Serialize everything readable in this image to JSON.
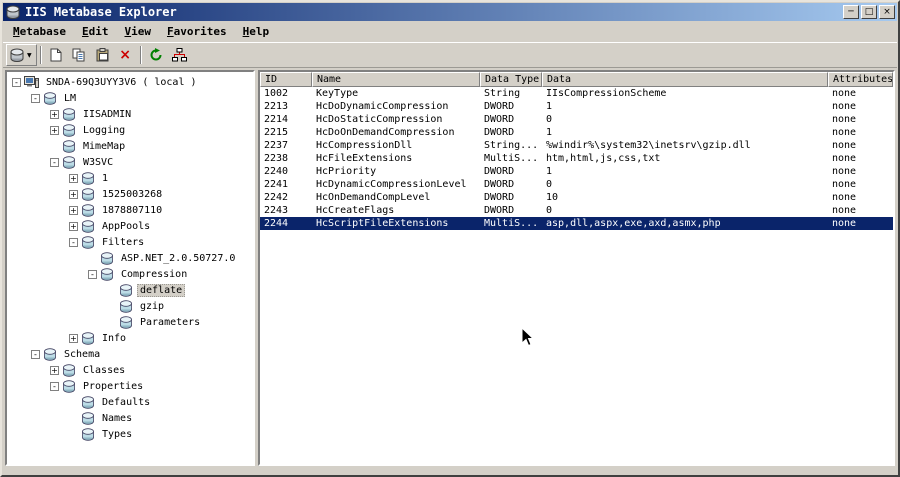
{
  "window": {
    "title": "IIS Metabase Explorer",
    "controls": {
      "minimize": "─",
      "maximize": "□",
      "close": "×"
    }
  },
  "menu": {
    "items": [
      {
        "label": "Metabase"
      },
      {
        "label": "Edit"
      },
      {
        "label": "View"
      },
      {
        "label": "Favorites"
      },
      {
        "label": "Help"
      }
    ]
  },
  "toolbar": {
    "buttons": [
      "connect",
      "new-key",
      "copy",
      "paste",
      "delete",
      "refresh",
      "network"
    ]
  },
  "tree": {
    "items": [
      {
        "label": "SNDA-69Q3UYY3V6 ( local )",
        "level": 0,
        "expander": "minus",
        "icon": "computer"
      },
      {
        "label": "LM",
        "level": 1,
        "expander": "minus",
        "icon": "db"
      },
      {
        "label": "IISADMIN",
        "level": 2,
        "expander": "plus",
        "icon": "db"
      },
      {
        "label": "Logging",
        "level": 2,
        "expander": "plus",
        "icon": "db"
      },
      {
        "label": "MimeMap",
        "level": 2,
        "expander": "none",
        "icon": "db"
      },
      {
        "label": "W3SVC",
        "level": 2,
        "expander": "minus",
        "icon": "db"
      },
      {
        "label": "1",
        "level": 3,
        "expander": "plus",
        "icon": "db"
      },
      {
        "label": "1525003268",
        "level": 3,
        "expander": "plus",
        "icon": "db"
      },
      {
        "label": "1878807110",
        "level": 3,
        "expander": "plus",
        "icon": "db"
      },
      {
        "label": "AppPools",
        "level": 3,
        "expander": "plus",
        "icon": "db"
      },
      {
        "label": "Filters",
        "level": 3,
        "expander": "minus",
        "icon": "db"
      },
      {
        "label": "ASP.NET_2.0.50727.0",
        "level": 4,
        "expander": "none",
        "icon": "db"
      },
      {
        "label": "Compression",
        "level": 4,
        "expander": "minus",
        "icon": "db"
      },
      {
        "label": "deflate",
        "level": 5,
        "expander": "none",
        "icon": "db",
        "selected": true
      },
      {
        "label": "gzip",
        "level": 5,
        "expander": "none",
        "icon": "db"
      },
      {
        "label": "Parameters",
        "level": 5,
        "expander": "none",
        "icon": "db"
      },
      {
        "label": "Info",
        "level": 3,
        "expander": "plus",
        "icon": "db"
      },
      {
        "label": "Schema",
        "level": 1,
        "expander": "minus",
        "icon": "db"
      },
      {
        "label": "Classes",
        "level": 2,
        "expander": "plus",
        "icon": "db"
      },
      {
        "label": "Properties",
        "level": 2,
        "expander": "minus",
        "icon": "db"
      },
      {
        "label": "Defaults",
        "level": 3,
        "expander": "none",
        "icon": "db"
      },
      {
        "label": "Names",
        "level": 3,
        "expander": "none",
        "icon": "db"
      },
      {
        "label": "Types",
        "level": 3,
        "expander": "none",
        "icon": "db"
      }
    ]
  },
  "table": {
    "columns": [
      "ID",
      "Name",
      "Data Type",
      "Data",
      "Attributes"
    ],
    "rows": [
      {
        "id": "1002",
        "name": "KeyType",
        "type": "String",
        "data": "IIsCompressionScheme",
        "attr": "none"
      },
      {
        "id": "2213",
        "name": "HcDoDynamicCompression",
        "type": "DWORD",
        "data": "1",
        "attr": "none"
      },
      {
        "id": "2214",
        "name": "HcDoStaticCompression",
        "type": "DWORD",
        "data": "0",
        "attr": "none"
      },
      {
        "id": "2215",
        "name": "HcDoOnDemandCompression",
        "type": "DWORD",
        "data": "1",
        "attr": "none"
      },
      {
        "id": "2237",
        "name": "HcCompressionDll",
        "type": "String...",
        "data": "%windir%\\system32\\inetsrv\\gzip.dll",
        "attr": "none"
      },
      {
        "id": "2238",
        "name": "HcFileExtensions",
        "type": "MultiS...",
        "data": "htm,html,js,css,txt",
        "attr": "none"
      },
      {
        "id": "2240",
        "name": "HcPriority",
        "type": "DWORD",
        "data": "1",
        "attr": "none"
      },
      {
        "id": "2241",
        "name": "HcDynamicCompressionLevel",
        "type": "DWORD",
        "data": "0",
        "attr": "none"
      },
      {
        "id": "2242",
        "name": "HcOnDemandCompLevel",
        "type": "DWORD",
        "data": "10",
        "attr": "none"
      },
      {
        "id": "2243",
        "name": "HcCreateFlags",
        "type": "DWORD",
        "data": "0",
        "attr": "none"
      },
      {
        "id": "2244",
        "name": "HcScriptFileExtensions",
        "type": "MultiS...",
        "data": "asp,dll,aspx,exe,axd,asmx,php",
        "attr": "none",
        "selected": true
      }
    ]
  },
  "colors": {
    "titlebar_start": "#0a246a",
    "titlebar_end": "#a6caf0",
    "selection": "#0a246a",
    "chrome": "#d4d0c8",
    "delete_red": "#cc0000"
  }
}
